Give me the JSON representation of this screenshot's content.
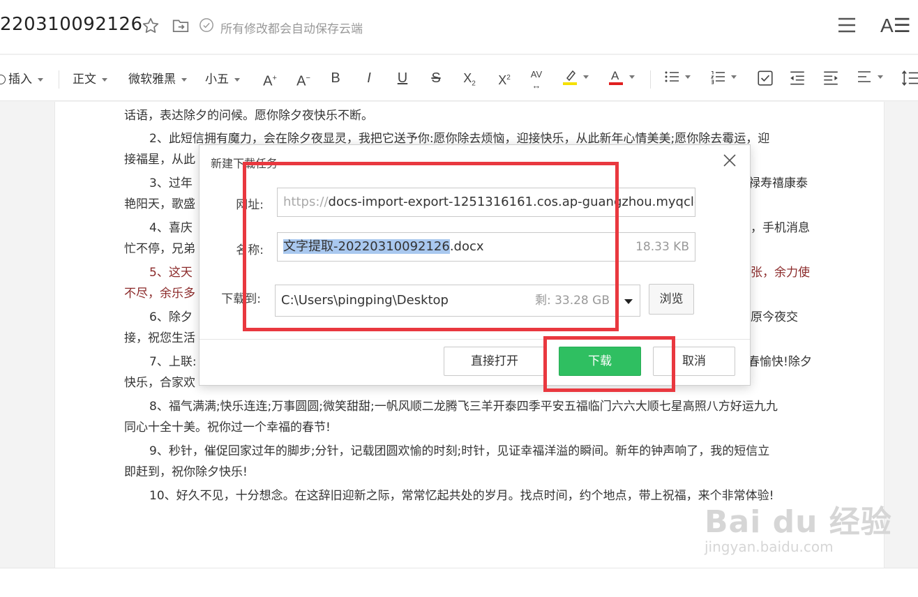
{
  "header": {
    "title": "220310092126",
    "save_status": "所有修改都会自动保存云端",
    "font_icon_label": "A☰"
  },
  "toolbar": {
    "insert": "插入",
    "style": "正文",
    "font": "微软雅黑",
    "size": "小五",
    "font_color_accent": "#e02020",
    "highlight_accent": "#f5e000"
  },
  "document": {
    "lines": [
      "话语，表达除夕的问候。愿你除夕夜快乐不断。",
      "2、此短信拥有魔力，会在除夕夜显灵，我把它送予你:愿你除去烦恼，迎接快乐，从此新年心情美美;愿你除去霉运，迎",
      "接福星，从此",
      "3、过年",
      "禄寿禧康泰",
      "艳阳天，歌盛",
      "4、喜庆",
      "，手机消息",
      "忙不停，兄弟",
      "5、这天",
      "张，余力使",
      "不尽，余乐多",
      "6、除夕",
      "原今夜交",
      "接，祝您生活",
      "7、上联:",
      "春愉快!除夕",
      "快乐，合家欢",
      "8、福气满满;快乐连连;万事圆圆;微笑甜甜;一帆风顺二龙腾飞三羊开泰四季平安五福临门六六大顺七星高照八方好运九九",
      "同心十全十美。祝你过一个幸福的春节!",
      "9、秒针，催促回家过年的脚步;分针，记载团圆欢愉的时刻;时针，见证幸福洋溢的瞬间。新年的钟声响了，我的短信立",
      "即赶到，祝你除夕快乐!",
      "10、好久不见，十分想念。在这辞旧迎新之际，常常忆起共处的岁月。找点时间，约个地点，带上祝福，来个非常体验!"
    ]
  },
  "dialog": {
    "title": "新建下载任务",
    "url_label": "网址:",
    "url_protocol": "https://",
    "url_rest": "docs-import-export-1251316161.cos.ap-guangzhou.myqclou",
    "name_label": "名称:",
    "name_selected": "文字提取-20220310092126",
    "name_ext": ".docx",
    "file_size": "18.33 KB",
    "dest_label": "下载到:",
    "dest_path": "C:\\Users\\pingping\\Desktop",
    "free_space": "剩: 33.28 GB",
    "browse": "浏览",
    "open_directly": "直接打开",
    "download": "下载",
    "cancel": "取消",
    "download_color": "#2fbf61"
  },
  "annotations": {
    "color": "#e9383f"
  },
  "watermark": {
    "main": "Bai du 经验",
    "sub": "jingyan.baidu.com"
  }
}
